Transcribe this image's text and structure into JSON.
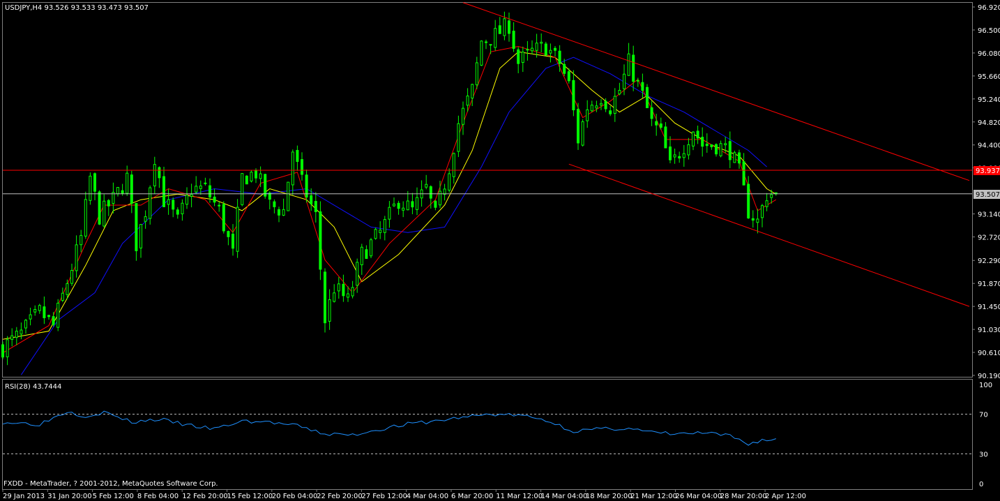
{
  "header": {
    "symbol_info": "USDJPY,H4  93.526 93.533 93.473 93.507"
  },
  "price_axis": {
    "labels": [
      "96.920",
      "96.500",
      "96.080",
      "95.660",
      "95.240",
      "94.820",
      "94.400",
      "93.980",
      "93.140",
      "92.720",
      "92.290",
      "91.870",
      "91.450",
      "91.030",
      "90.610",
      "90.190"
    ],
    "current_price_label": "93.507",
    "resistance_label": "93.937"
  },
  "time_axis": {
    "labels": [
      "29 Jan 2013",
      "31 Jan 20:00",
      "5 Feb 12:00",
      "8 Feb 04:00",
      "12 Feb 20:00",
      "15 Feb 12:00",
      "20 Feb 04:00",
      "22 Feb 20:00",
      "27 Feb 12:00",
      "4 Mar 04:00",
      "6 Mar 20:00",
      "11 Mar 12:00",
      "14 Mar 04:00",
      "18 Mar 20:00",
      "21 Mar 12:00",
      "26 Mar 04:00",
      "28 Mar 20:00",
      "2 Apr 12:00"
    ]
  },
  "rsi": {
    "title": "RSI(28) 43.7444",
    "axis_labels": [
      "100",
      "70",
      "30",
      "0"
    ]
  },
  "footer": {
    "copyright": "FXDD - MetaTrader, ? 2001-2012, MetaQuotes Software Corp."
  },
  "colors": {
    "candle": "#00ff00",
    "ma_fast": "#ff0000",
    "ma_mid": "#ffff00",
    "ma_slow": "#1010ff",
    "trendline": "#ff0000",
    "rsi": "#1e90ff",
    "current_price_line": "#c0c0c0"
  },
  "chart_data": {
    "type": "candlestick",
    "symbol": "USDJPY",
    "timeframe": "H4",
    "last": {
      "open": 93.526,
      "high": 93.533,
      "low": 93.473,
      "close": 93.507
    },
    "ylim": [
      90.19,
      96.92
    ],
    "resistance_level": 93.937,
    "close_path": [
      [
        0,
        90.7
      ],
      [
        4,
        90.95
      ],
      [
        8,
        91.35
      ],
      [
        11,
        91.1
      ],
      [
        14,
        91.9
      ],
      [
        17,
        92.7
      ],
      [
        19,
        93.8
      ],
      [
        21,
        93.1
      ],
      [
        24,
        93.4
      ],
      [
        27,
        93.8
      ],
      [
        29,
        92.6
      ],
      [
        31,
        93.2
      ],
      [
        33,
        94.2
      ],
      [
        35,
        93.4
      ],
      [
        38,
        93.0
      ],
      [
        41,
        93.6
      ],
      [
        44,
        93.6
      ],
      [
        47,
        93.2
      ],
      [
        50,
        92.4
      ],
      [
        52,
        93.8
      ],
      [
        55,
        93.9
      ],
      [
        58,
        93.3
      ],
      [
        61,
        93.2
      ],
      [
        63,
        94.3
      ],
      [
        65,
        93.7
      ],
      [
        68,
        93.1
      ],
      [
        70,
        91.2
      ],
      [
        72,
        91.8
      ],
      [
        75,
        91.55
      ],
      [
        78,
        92.4
      ],
      [
        82,
        92.8
      ],
      [
        86,
        93.4
      ],
      [
        89,
        93.2
      ],
      [
        92,
        93.6
      ],
      [
        94,
        93.1
      ],
      [
        97,
        94.0
      ],
      [
        99,
        94.8
      ],
      [
        102,
        95.4
      ],
      [
        104,
        96.3
      ],
      [
        107,
        96.4
      ],
      [
        110,
        96.6
      ],
      [
        112,
        95.9
      ],
      [
        115,
        96.1
      ],
      [
        118,
        96.2
      ],
      [
        121,
        95.9
      ],
      [
        123,
        95.5
      ],
      [
        125,
        94.5
      ],
      [
        127,
        95.1
      ],
      [
        130,
        95.3
      ],
      [
        132,
        95.1
      ],
      [
        134,
        95.4
      ],
      [
        136,
        95.9
      ],
      [
        139,
        95.3
      ],
      [
        141,
        94.8
      ],
      [
        143,
        94.6
      ],
      [
        145,
        94.0
      ],
      [
        148,
        94.4
      ],
      [
        150,
        94.7
      ],
      [
        152,
        94.4
      ],
      [
        155,
        94.4
      ],
      [
        158,
        94.3
      ],
      [
        160,
        93.9
      ],
      [
        162,
        93.2
      ],
      [
        164,
        93.0
      ],
      [
        166,
        93.5
      ],
      [
        168,
        93.51
      ]
    ],
    "ma_fast_path": [
      [
        0,
        90.6
      ],
      [
        10,
        91.1
      ],
      [
        18,
        92.6
      ],
      [
        22,
        93.3
      ],
      [
        30,
        93.3
      ],
      [
        36,
        93.6
      ],
      [
        44,
        93.4
      ],
      [
        50,
        92.8
      ],
      [
        56,
        93.7
      ],
      [
        64,
        93.9
      ],
      [
        70,
        92.3
      ],
      [
        76,
        91.7
      ],
      [
        84,
        92.6
      ],
      [
        94,
        93.4
      ],
      [
        100,
        94.8
      ],
      [
        106,
        96.1
      ],
      [
        112,
        96.2
      ],
      [
        120,
        96.0
      ],
      [
        126,
        94.9
      ],
      [
        132,
        95.2
      ],
      [
        138,
        95.6
      ],
      [
        144,
        94.5
      ],
      [
        152,
        94.5
      ],
      [
        160,
        94.1
      ],
      [
        164,
        93.2
      ],
      [
        168,
        93.4
      ]
    ],
    "ma_mid_path": [
      [
        0,
        90.85
      ],
      [
        10,
        91.0
      ],
      [
        18,
        92.2
      ],
      [
        24,
        93.2
      ],
      [
        30,
        93.4
      ],
      [
        38,
        93.5
      ],
      [
        46,
        93.4
      ],
      [
        52,
        93.2
      ],
      [
        58,
        93.6
      ],
      [
        66,
        93.4
      ],
      [
        72,
        92.9
      ],
      [
        78,
        91.9
      ],
      [
        86,
        92.4
      ],
      [
        96,
        93.3
      ],
      [
        102,
        94.3
      ],
      [
        108,
        95.8
      ],
      [
        112,
        96.1
      ],
      [
        120,
        96.0
      ],
      [
        128,
        95.4
      ],
      [
        134,
        95.0
      ],
      [
        140,
        95.3
      ],
      [
        146,
        94.8
      ],
      [
        154,
        94.4
      ],
      [
        160,
        94.2
      ],
      [
        166,
        93.6
      ],
      [
        168,
        93.5
      ]
    ],
    "ma_slow_path": [
      [
        4,
        90.2
      ],
      [
        12,
        91.2
      ],
      [
        20,
        91.7
      ],
      [
        26,
        92.6
      ],
      [
        36,
        93.4
      ],
      [
        46,
        93.6
      ],
      [
        56,
        93.5
      ],
      [
        66,
        93.6
      ],
      [
        74,
        93.2
      ],
      [
        80,
        92.9
      ],
      [
        88,
        92.8
      ],
      [
        96,
        92.9
      ],
      [
        104,
        94.0
      ],
      [
        110,
        95.0
      ],
      [
        118,
        95.8
      ],
      [
        124,
        96.0
      ],
      [
        132,
        95.7
      ],
      [
        140,
        95.3
      ],
      [
        148,
        95.0
      ],
      [
        156,
        94.6
      ],
      [
        162,
        94.3
      ],
      [
        166,
        94.0
      ]
    ],
    "channel_upper": [
      [
        100,
        97.0
      ],
      [
        210,
        93.75
      ]
    ],
    "channel_lower": [
      [
        123,
        94.05
      ],
      [
        210,
        91.45
      ]
    ],
    "rsi_path": [
      [
        0,
        62
      ],
      [
        8,
        60
      ],
      [
        14,
        73
      ],
      [
        18,
        68
      ],
      [
        22,
        72
      ],
      [
        28,
        62
      ],
      [
        34,
        65
      ],
      [
        40,
        59
      ],
      [
        46,
        55
      ],
      [
        52,
        63
      ],
      [
        58,
        62
      ],
      [
        64,
        58
      ],
      [
        70,
        50
      ],
      [
        76,
        49
      ],
      [
        82,
        55
      ],
      [
        88,
        60
      ],
      [
        94,
        63
      ],
      [
        100,
        67
      ],
      [
        106,
        70
      ],
      [
        112,
        69
      ],
      [
        118,
        64
      ],
      [
        124,
        53
      ],
      [
        130,
        55
      ],
      [
        136,
        56
      ],
      [
        140,
        52
      ],
      [
        146,
        50
      ],
      [
        152,
        51
      ],
      [
        158,
        48
      ],
      [
        162,
        40
      ],
      [
        165,
        44
      ],
      [
        168,
        44
      ]
    ],
    "rsi_levels": [
      70,
      30
    ]
  }
}
